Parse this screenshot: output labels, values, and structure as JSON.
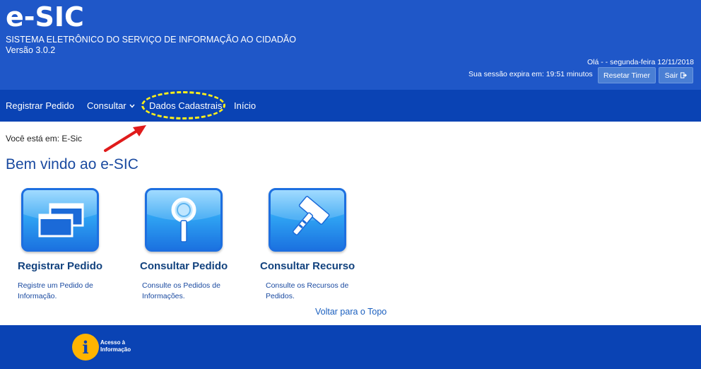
{
  "header": {
    "logo": "e-SIC",
    "subtitle": "SISTEMA ELETRÔNICO DO SERVIÇO DE INFORMAÇÃO AO CIDADÃO",
    "version": "Versão 3.0.2",
    "greeting": "Olá - - segunda-feira 12/11/2018",
    "session": "Sua sessão expira em: 19:51 minutos",
    "reset_label": "Resetar Timer",
    "sair_label": "Sair"
  },
  "nav": {
    "registrar": "Registrar Pedido",
    "consultar": "Consultar",
    "dados": "Dados Cadastrais",
    "inicio": "Início"
  },
  "breadcrumb": "Você está em: E-Sic",
  "welcome": "Bem vindo ao e-SIC",
  "items": [
    {
      "title": "Registrar Pedido",
      "desc": "Registre um Pedido de Informação.",
      "icon": "windows-icon"
    },
    {
      "title": "Consultar Pedido",
      "desc": "Consulte os Pedidos de Informações.",
      "icon": "magnifier-icon"
    },
    {
      "title": "Consultar Recurso",
      "desc": "Consulte os Recursos de Pedidos.",
      "icon": "gavel-icon"
    }
  ],
  "back_to_top": "Voltar para o Topo",
  "footer": {
    "info_text": "Acesso à Informação"
  },
  "colors": {
    "header_blue": "#1f57c8",
    "nav_blue": "#0a43b4",
    "highlight_yellow": "#ffef1a",
    "arrow_red": "#e01b1b"
  }
}
